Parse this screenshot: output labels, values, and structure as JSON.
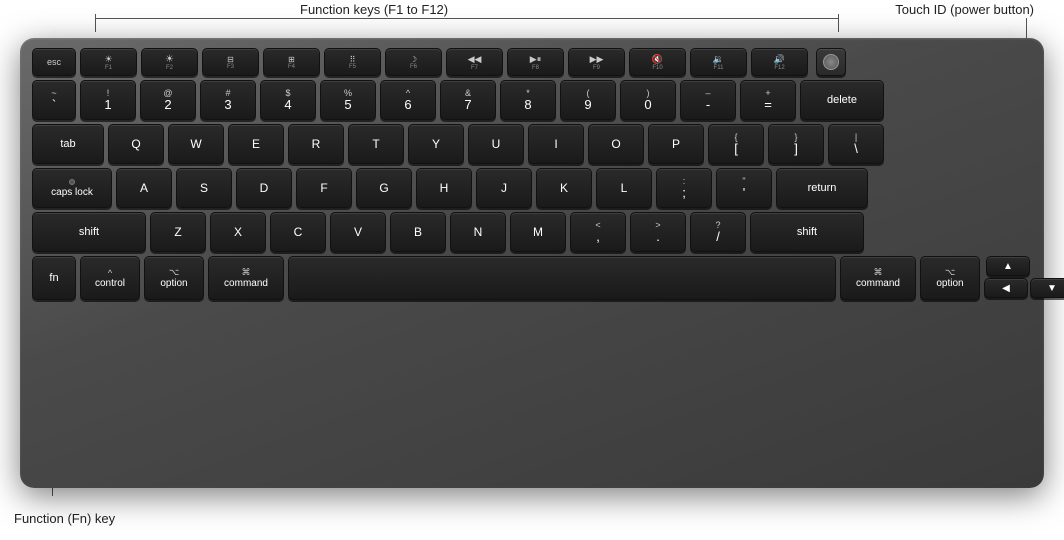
{
  "annotations": {
    "function_keys_label": "Function keys (F1 to F12)",
    "touchid_label": "Touch ID (power button)",
    "fn_key_label": "Function (Fn) key"
  },
  "keyboard": {
    "rows": {
      "fn_row": [
        "esc",
        "F1",
        "F2",
        "F3",
        "F4",
        "F5",
        "F6",
        "F7",
        "F8",
        "F9",
        "F10",
        "F11",
        "F12",
        "TouchID"
      ],
      "num_row": [
        "~`",
        "!1",
        "@2",
        "#3",
        "$4",
        "%5",
        "^6",
        "&7",
        "*8",
        "(9",
        ")0",
        "-",
        "=+",
        "delete"
      ],
      "tab_row": [
        "tab",
        "Q",
        "W",
        "E",
        "R",
        "T",
        "Y",
        "U",
        "I",
        "O",
        "P",
        "{[",
        "}]",
        "|\\"
      ],
      "caps_row": [
        "caps lock",
        "A",
        "S",
        "D",
        "F",
        "G",
        "H",
        "J",
        "K",
        "L",
        ";:",
        "'\"",
        "return"
      ],
      "shift_row": [
        "shift",
        "Z",
        "X",
        "C",
        "V",
        "B",
        "N",
        "M",
        "<,",
        ">.",
        "?/",
        "shift"
      ],
      "bottom_row": [
        "fn",
        "control",
        "option",
        "command",
        "space",
        "command",
        "option",
        "arrows"
      ]
    }
  }
}
